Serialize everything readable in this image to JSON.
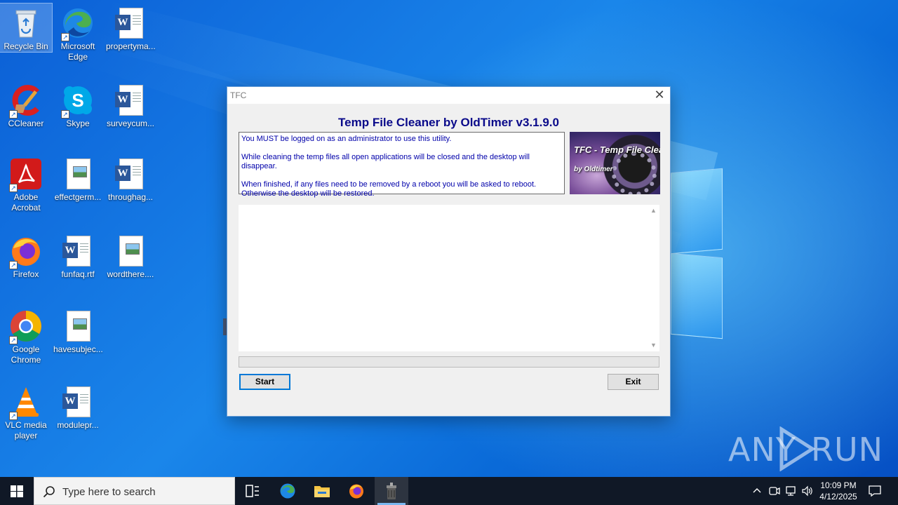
{
  "desktop": {
    "icons": [
      {
        "label": "Recycle Bin"
      },
      {
        "label": "Microsoft Edge"
      },
      {
        "label": "propertyma..."
      },
      {
        "label": "CCleaner"
      },
      {
        "label": "Skype"
      },
      {
        "label": "surveycum..."
      },
      {
        "label": "Adobe Acrobat"
      },
      {
        "label": "effectgerm..."
      },
      {
        "label": "throughag..."
      },
      {
        "label": "Firefox"
      },
      {
        "label": "funfaq.rtf"
      },
      {
        "label": "wordthere...."
      },
      {
        "label": "Google Chrome"
      },
      {
        "label": "havesubjec..."
      },
      {
        "label": "VLC media player"
      },
      {
        "label": "modulepr..."
      }
    ]
  },
  "tfc": {
    "window_title": "TFC",
    "app_title": "Temp File Cleaner by OldTimer v3.1.9.0",
    "info": {
      "line1": "You MUST be logged on as an administrator to use this utility.",
      "line2": "While cleaning the temp files all open applications will be closed and the desktop will disappear.",
      "line3": "When finished, if any files need to be removed by a reboot you will be asked to reboot.",
      "line4": "Otherwise the desktop will be restored."
    },
    "logo_text": "TFC - Temp File Cleaner",
    "logo_subtext": "by Oldtimer",
    "start_label": "Start",
    "exit_label": "Exit",
    "progress": 0
  },
  "watermark": {
    "left": "ANY",
    "right": "RUN"
  },
  "taskbar": {
    "search_placeholder": "Type here to search",
    "time": "10:09 PM",
    "date": "4/12/2025"
  },
  "colors": {
    "accent": "#0078d7",
    "app_title": "#0a0a8a",
    "info_text": "#0000aa",
    "taskbar": "#101826"
  }
}
